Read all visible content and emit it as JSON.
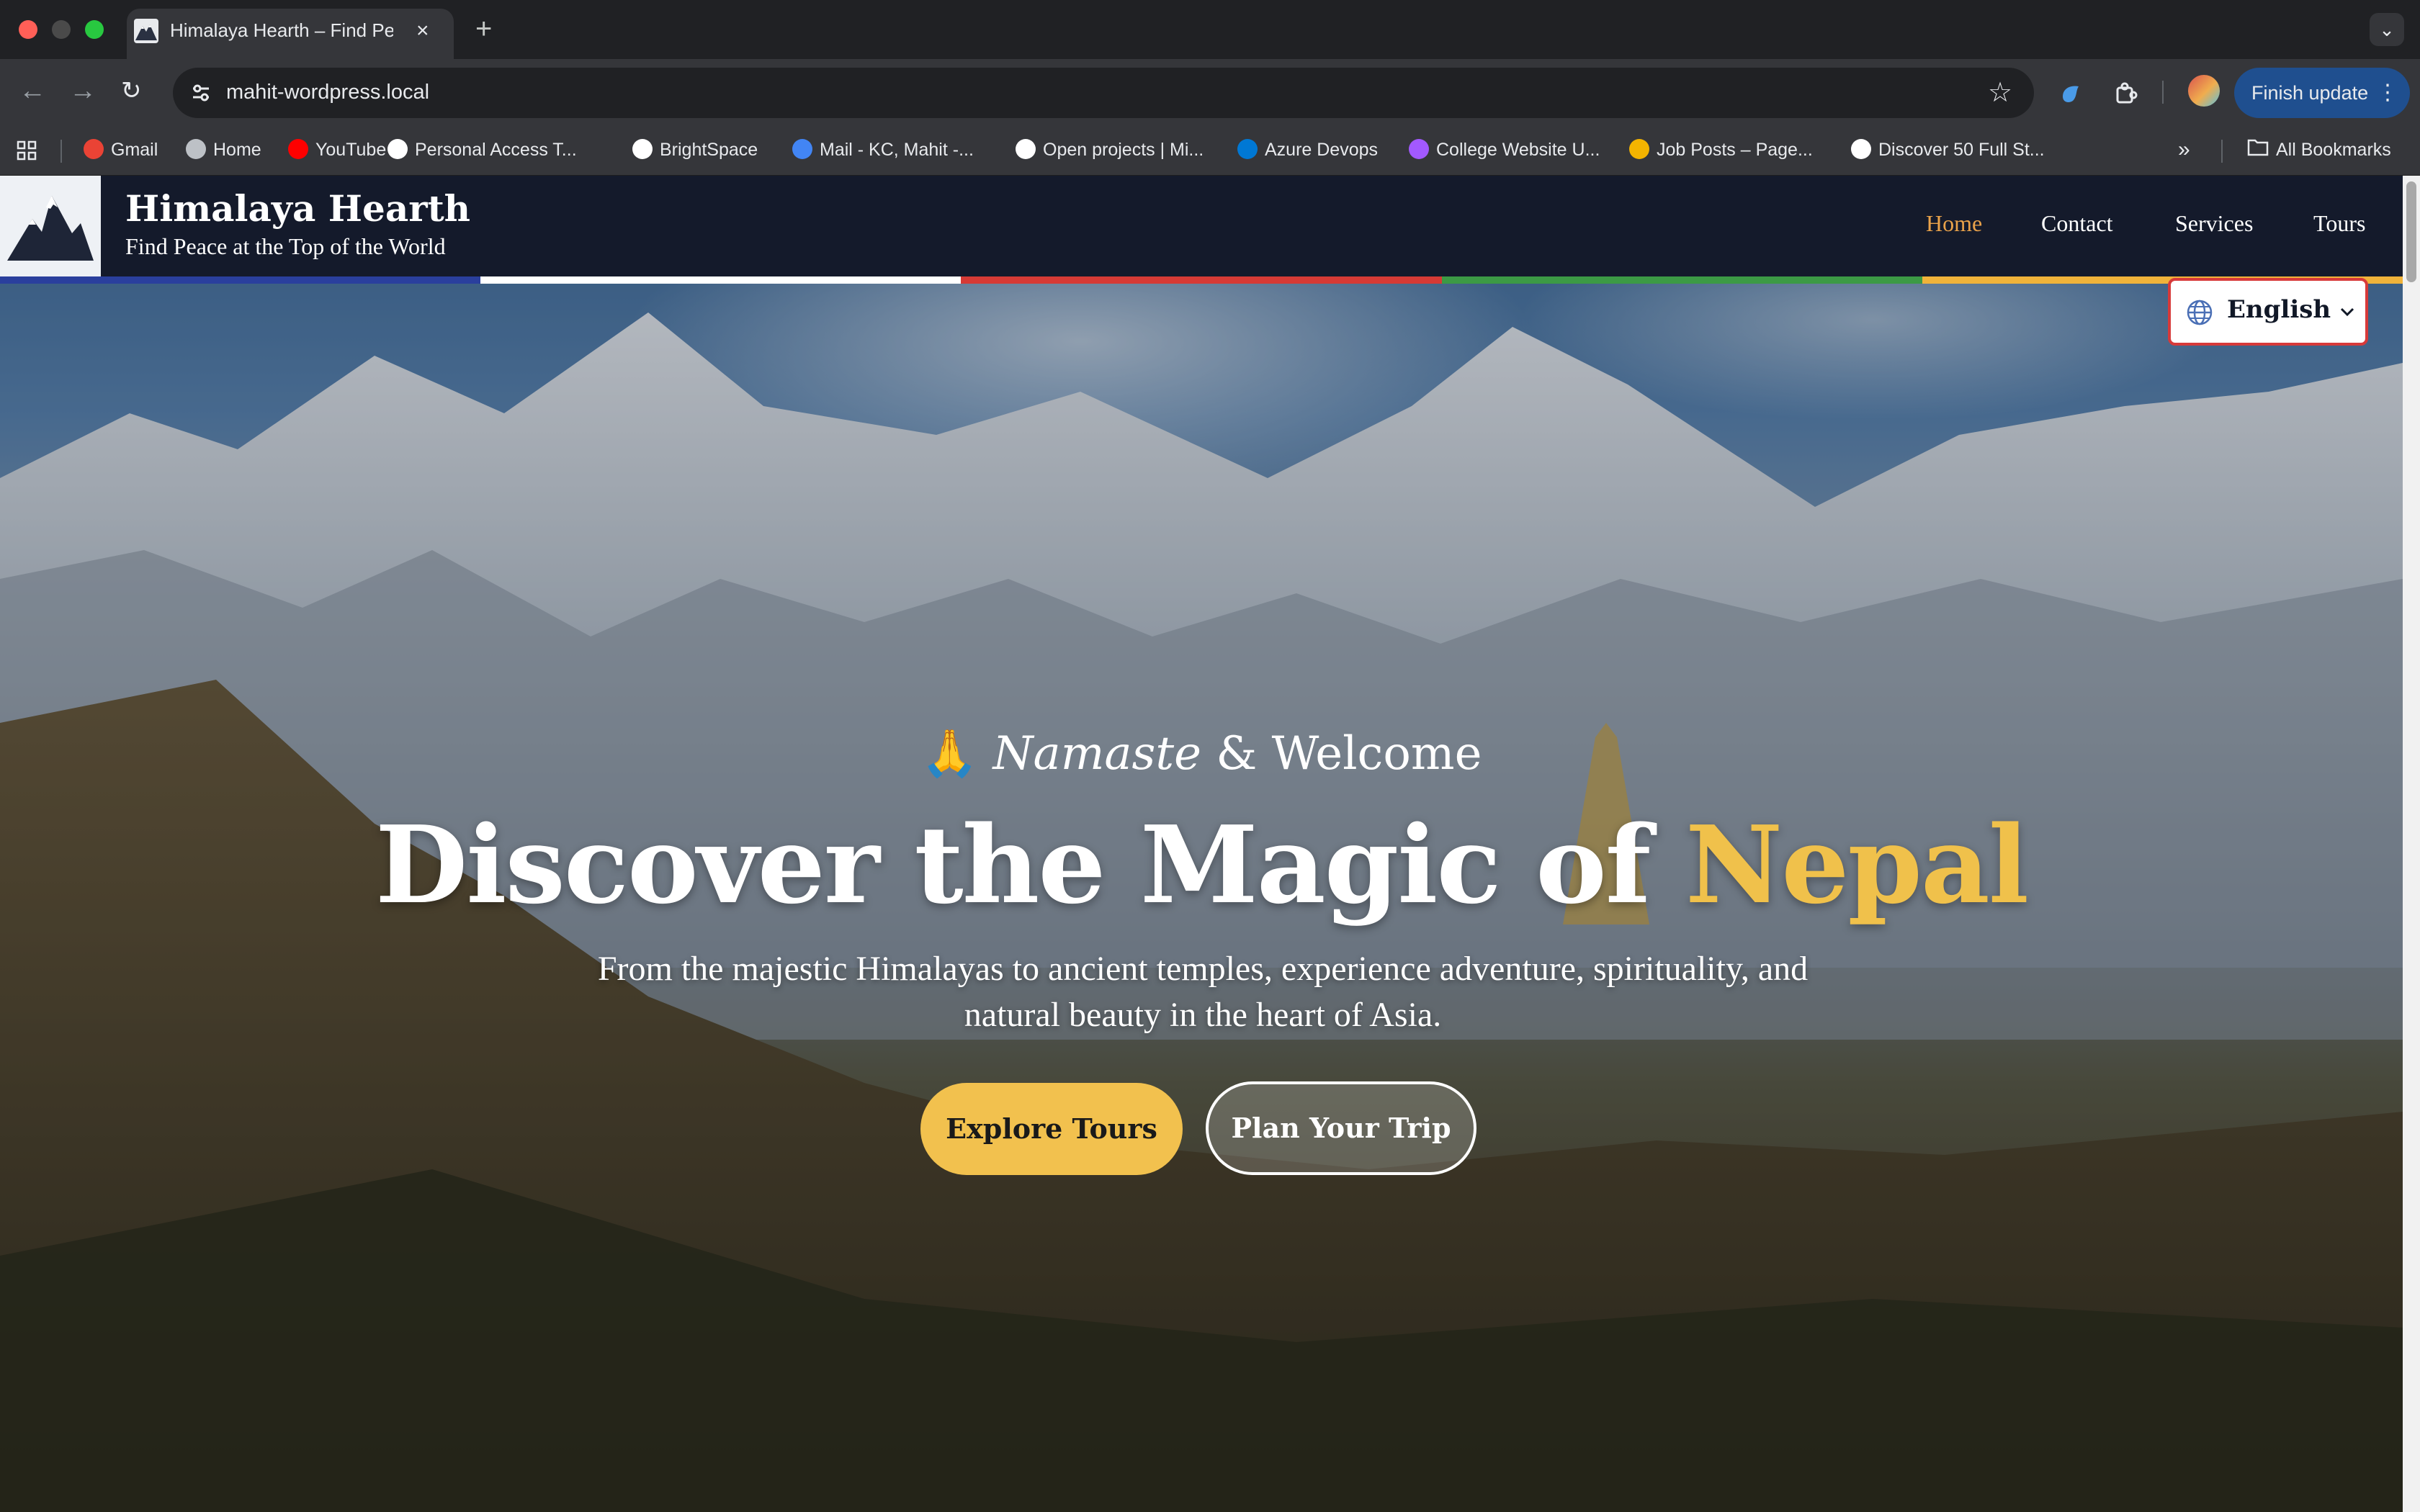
{
  "browser": {
    "tab": {
      "title": "Himalaya Hearth – Find Peace at the Top of the World",
      "close_icon": "×"
    },
    "new_tab_icon": "+",
    "address": {
      "url": "mahit-wordpress.local"
    },
    "finish_update": "Finish update"
  },
  "bookmarks": {
    "items": [
      {
        "label": "Gmail",
        "icon": "gmail-icon",
        "color": "#ea4335"
      },
      {
        "label": "Home",
        "icon": "globe-icon",
        "color": "#bdc1c6"
      },
      {
        "label": "YouTube",
        "icon": "youtube-icon",
        "color": "#ff0000"
      },
      {
        "label": "Personal Access T...",
        "icon": "github-icon",
        "color": "#ffffff"
      },
      {
        "label": "BrightSpace",
        "icon": "d2l-icon",
        "color": "#ffffff"
      },
      {
        "label": "Mail - KC, Mahit -...",
        "icon": "mail-icon",
        "color": "#4285f4"
      },
      {
        "label": "Open projects | Mi...",
        "icon": "projects-icon",
        "color": "#ffffff"
      },
      {
        "label": "Azure Devops",
        "icon": "azure-icon",
        "color": "#0078d4"
      },
      {
        "label": "College Website U...",
        "icon": "figma-icon",
        "color": "#a259ff"
      },
      {
        "label": "Job Posts – Page...",
        "icon": "jobs-icon",
        "color": "#f4b400"
      },
      {
        "label": "Discover 50 Full St...",
        "icon": "info-icon",
        "color": "#ffffff"
      }
    ],
    "overflow_icon": "»",
    "all_bookmarks": "All Bookmarks"
  },
  "site": {
    "brand": {
      "title": "Himalaya Hearth",
      "tagline": "Find Peace at the Top of the World"
    },
    "nav": [
      {
        "label": "Home",
        "active": true
      },
      {
        "label": "Contact",
        "active": false
      },
      {
        "label": "Services",
        "active": false
      },
      {
        "label": "Tours",
        "active": false
      }
    ],
    "flag_colors": [
      "#2a3f9d",
      "#ffffff",
      "#d63a35",
      "#3c9a45",
      "#f0b33a"
    ],
    "language": {
      "selected": "English"
    },
    "accent_color": "#f2c14e",
    "nav_active_color": "#e9a24a"
  },
  "hero": {
    "emoji": "🙏",
    "welcome_italic": "Namaste",
    "welcome_rest": " & Welcome",
    "title_main": "Discover the Magic of ",
    "title_accent": "Nepal",
    "subtitle": "From the majestic Himalayas to ancient temples, experience adventure, spirituality, and natural beauty in the heart of Asia.",
    "primary_button": "Explore Tours",
    "secondary_button": "Plan Your Trip"
  }
}
